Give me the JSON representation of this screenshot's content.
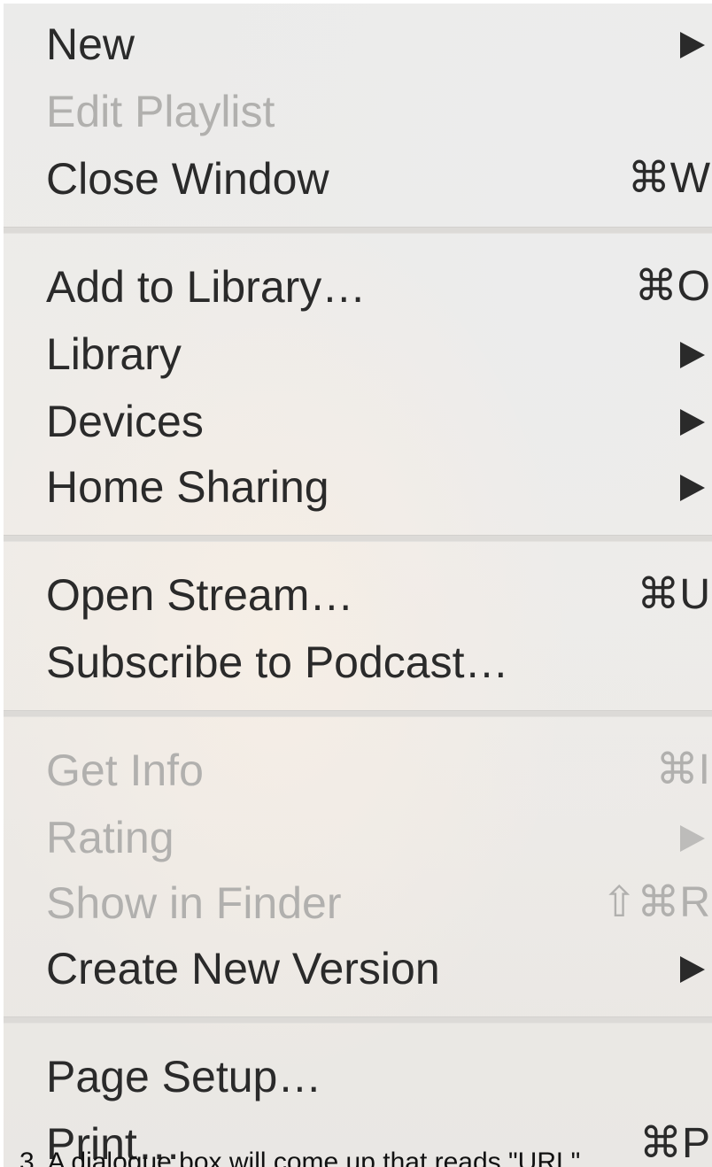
{
  "menu": {
    "items": [
      {
        "label": "New",
        "submenu": true,
        "enabled": true
      },
      {
        "label": "Edit Playlist",
        "enabled": false
      },
      {
        "label": "Close Window",
        "shortcut": "⌘W",
        "enabled": true
      },
      {
        "label": "Add to Library…",
        "shortcut": "⌘O",
        "enabled": true
      },
      {
        "label": "Library",
        "submenu": true,
        "enabled": true
      },
      {
        "label": "Devices",
        "submenu": true,
        "enabled": true
      },
      {
        "label": "Home Sharing",
        "submenu": true,
        "enabled": true
      },
      {
        "label": "Open Stream…",
        "shortcut": "⌘U",
        "enabled": true
      },
      {
        "label": "Subscribe to Podcast…",
        "enabled": true
      },
      {
        "label": "Get Info",
        "shortcut": "⌘I",
        "enabled": false
      },
      {
        "label": "Rating",
        "submenu": true,
        "enabled": false
      },
      {
        "label": "Show in Finder",
        "shortcut": "⇧⌘R",
        "enabled": false
      },
      {
        "label": "Create New Version",
        "submenu": true,
        "enabled": true
      },
      {
        "label": "Page Setup…",
        "enabled": true
      },
      {
        "label": "Print…",
        "shortcut": "⌘P",
        "enabled": true
      }
    ]
  },
  "caption": "3.  A dialogue box will come up that reads \"URL\"",
  "colors": {
    "menu_background": "#ecebe8",
    "text_enabled": "#2a2a2a",
    "text_disabled": "#b1b0ae",
    "separator": "#dcdad7"
  }
}
